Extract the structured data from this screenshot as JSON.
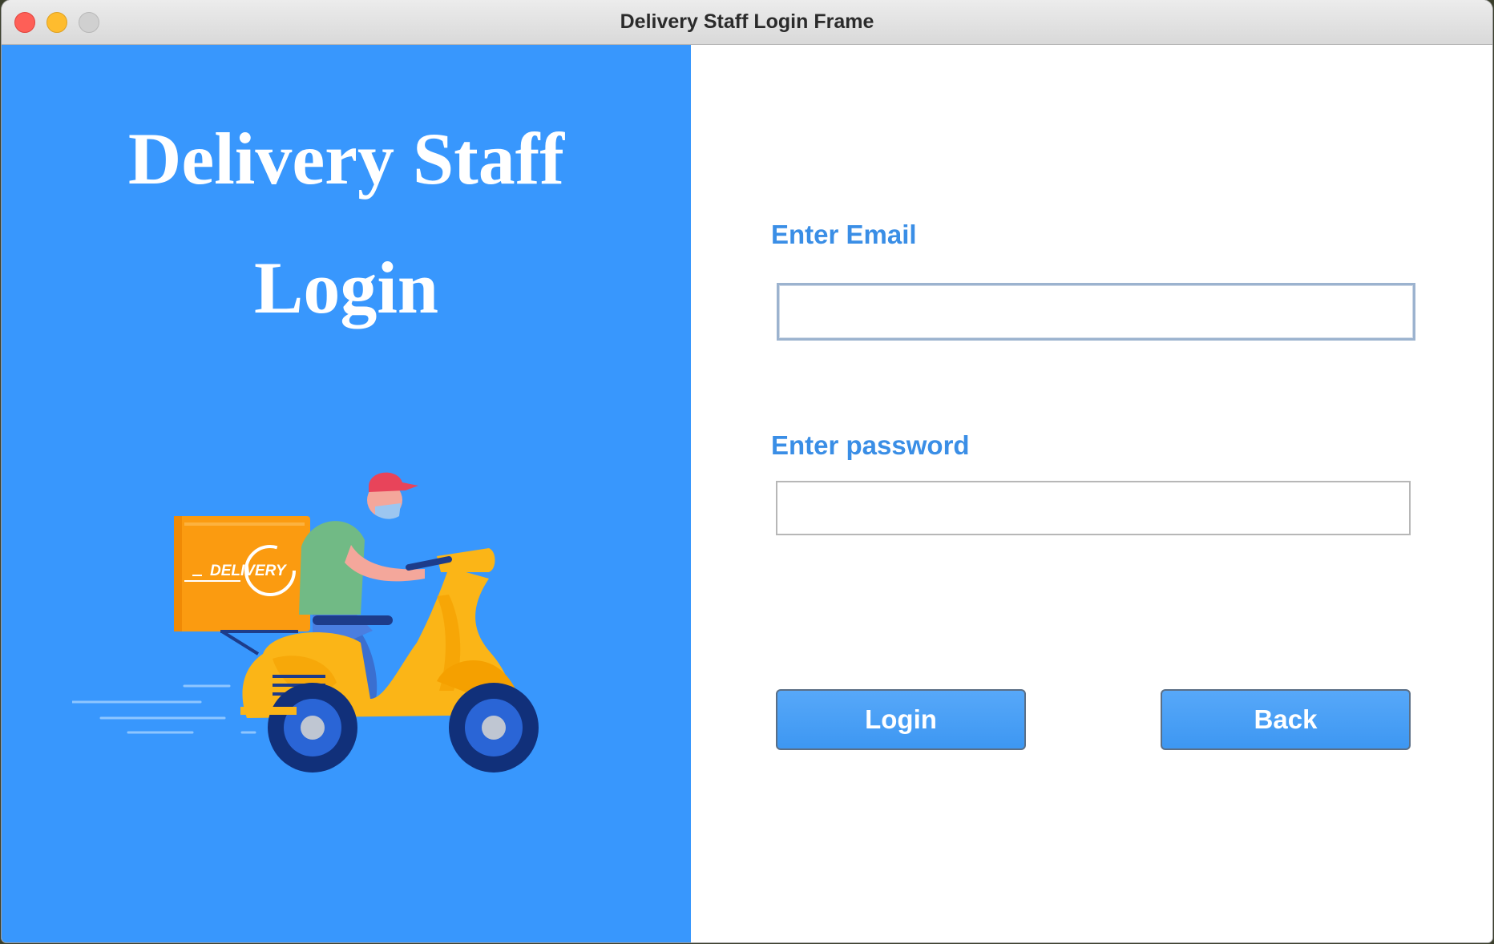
{
  "window": {
    "title": "Delivery Staff Login Frame"
  },
  "hero": {
    "line1": "Delivery Staff",
    "line2": "Login",
    "illustration": {
      "icon": "delivery-scooter-illustration",
      "box_text": "DELIVERY"
    }
  },
  "form": {
    "email_label": "Enter Email",
    "email_value": "",
    "password_label": "Enter password",
    "password_value": "",
    "login_label": "Login",
    "back_label": "Back"
  },
  "colors": {
    "panel_blue": "#3897fd",
    "label_blue": "#3a8ee6",
    "button_blue": "#4a9ff6",
    "box_orange": "#fb9b10",
    "scooter_yellow": "#fbb517"
  }
}
